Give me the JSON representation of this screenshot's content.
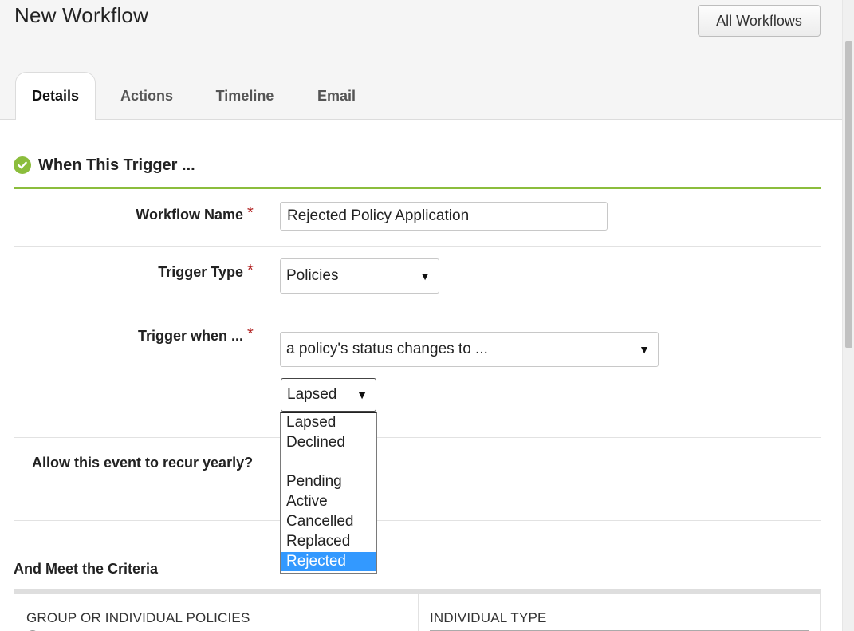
{
  "header": {
    "title": "New Workflow",
    "all_workflows_label": "All Workflows"
  },
  "tabs": [
    {
      "label": "Details",
      "active": true
    },
    {
      "label": "Actions",
      "active": false
    },
    {
      "label": "Timeline",
      "active": false
    },
    {
      "label": "Email",
      "active": false
    }
  ],
  "section": {
    "title": "When This Trigger ...",
    "icon": "check-circle-icon",
    "accent_color": "#8bbd3c"
  },
  "form": {
    "required_mark": "*",
    "workflow_name_label": "Workflow Name",
    "workflow_name_value": "Rejected Policy Application",
    "trigger_type_label": "Trigger Type",
    "trigger_type_value": "Policies",
    "trigger_when_label": "Trigger when ...",
    "trigger_when_value": "a policy's status changes to ...",
    "status_value": "Lapsed",
    "status_options": [
      "Lapsed",
      "Declined",
      "",
      "Pending",
      "Active",
      "Cancelled",
      "Replaced",
      "Rejected"
    ],
    "status_highlighted": "Rejected",
    "recur_label": "Allow this event to recur yearly?"
  },
  "criteria": {
    "title": "And Meet the Criteria",
    "col_1_header": "GROUP OR INDIVIDUAL POLICIES",
    "col_2_header": "INDIVIDUAL TYPE"
  },
  "icons": {
    "dropdown_arrow": "▼"
  }
}
